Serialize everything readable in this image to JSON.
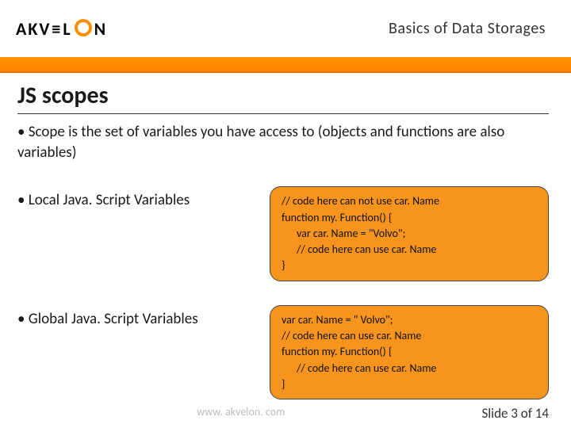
{
  "header": {
    "logo_pre": "AKV",
    "logo_mid": "L",
    "logo_post": "N",
    "title": "Basics of Data Storages"
  },
  "slide": {
    "title": "JS scopes",
    "intro": "Scope is the set of variables you have access to (objects and functions are also variables)",
    "bullets": [
      {
        "label": "Local Java. Script Variables",
        "code": [
          "// code here can not use car. Name",
          "function my. Function() {",
          "      var car. Name = \"Volvo\";",
          "      // code here can use car. Name",
          "}"
        ]
      },
      {
        "label": "Global Java. Script Variables",
        "code": [
          "var car. Name = \" Volvo\";",
          "// code here can use car. Name",
          "function my. Function() {",
          "      // code here can use car. Name",
          "}"
        ]
      }
    ]
  },
  "footer": {
    "url": "www. akvelon. com",
    "page": "Slide 3 of 14"
  }
}
